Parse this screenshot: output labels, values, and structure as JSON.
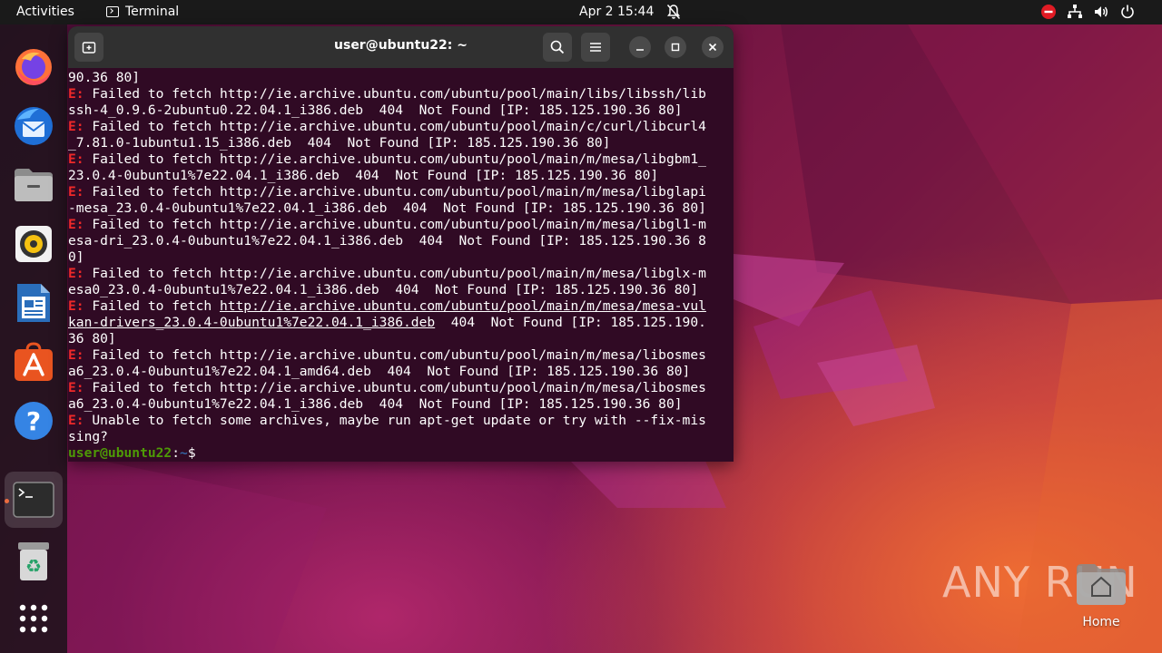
{
  "topbar": {
    "activities": "Activities",
    "app_name": "Terminal",
    "clock": "Apr 2  15:44"
  },
  "dock": {
    "items": [
      {
        "name": "firefox-icon"
      },
      {
        "name": "thunderbird-icon"
      },
      {
        "name": "files-icon"
      },
      {
        "name": "rhythmbox-icon"
      },
      {
        "name": "libreoffice-writer-icon"
      },
      {
        "name": "app-center-icon"
      },
      {
        "name": "help-icon"
      },
      {
        "name": "terminal-icon"
      },
      {
        "name": "trash-icon"
      },
      {
        "name": "show-apps-icon"
      }
    ]
  },
  "terminal": {
    "title": "user@ubuntu22: ~",
    "lines": [
      {
        "e": "",
        "t": "90.36 80]"
      },
      {
        "e": "E:",
        "t": " Failed to fetch http://ie.archive.ubuntu.com/ubuntu/pool/main/libs/libssh/lib"
      },
      {
        "e": "",
        "t": "ssh-4_0.9.6-2ubuntu0.22.04.1_i386.deb  404  Not Found [IP: 185.125.190.36 80]"
      },
      {
        "e": "E:",
        "t": " Failed to fetch http://ie.archive.ubuntu.com/ubuntu/pool/main/c/curl/libcurl4"
      },
      {
        "e": "",
        "t": "_7.81.0-1ubuntu1.15_i386.deb  404  Not Found [IP: 185.125.190.36 80]"
      },
      {
        "e": "E:",
        "t": " Failed to fetch http://ie.archive.ubuntu.com/ubuntu/pool/main/m/mesa/libgbm1_"
      },
      {
        "e": "",
        "t": "23.0.4-0ubuntu1%7e22.04.1_i386.deb  404  Not Found [IP: 185.125.190.36 80]"
      },
      {
        "e": "E:",
        "t": " Failed to fetch http://ie.archive.ubuntu.com/ubuntu/pool/main/m/mesa/libglapi"
      },
      {
        "e": "",
        "t": "-mesa_23.0.4-0ubuntu1%7e22.04.1_i386.deb  404  Not Found [IP: 185.125.190.36 80]"
      },
      {
        "e": "E:",
        "t": " Failed to fetch http://ie.archive.ubuntu.com/ubuntu/pool/main/m/mesa/libgl1-m"
      },
      {
        "e": "",
        "t": "esa-dri_23.0.4-0ubuntu1%7e22.04.1_i386.deb  404  Not Found [IP: 185.125.190.36 8"
      },
      {
        "e": "",
        "t": "0]"
      },
      {
        "e": "E:",
        "t": " Failed to fetch http://ie.archive.ubuntu.com/ubuntu/pool/main/m/mesa/libglx-m"
      },
      {
        "e": "",
        "t": "esa0_23.0.4-0ubuntu1%7e22.04.1_i386.deb  404  Not Found [IP: 185.125.190.36 80]"
      },
      {
        "e": "E:",
        "t": " Failed to fetch ",
        "link": "http://ie.archive.ubuntu.com/ubuntu/pool/main/m/mesa/mesa-vul"
      },
      {
        "e": "",
        "t": "",
        "link": "kan-drivers_23.0.4-0ubuntu1%7e22.04.1_i386.deb",
        "after": "  404  Not Found [IP: 185.125.190."
      },
      {
        "e": "",
        "t": "36 80]"
      },
      {
        "e": "E:",
        "t": " Failed to fetch http://ie.archive.ubuntu.com/ubuntu/pool/main/m/mesa/libosmes"
      },
      {
        "e": "",
        "t": "a6_23.0.4-0ubuntu1%7e22.04.1_amd64.deb  404  Not Found [IP: 185.125.190.36 80]"
      },
      {
        "e": "E:",
        "t": " Failed to fetch http://ie.archive.ubuntu.com/ubuntu/pool/main/m/mesa/libosmes"
      },
      {
        "e": "",
        "t": "a6_23.0.4-0ubuntu1%7e22.04.1_i386.deb  404  Not Found [IP: 185.125.190.36 80]"
      },
      {
        "e": "E:",
        "t": " Unable to fetch some archives, maybe run apt-get update or try with --fix-mis"
      },
      {
        "e": "",
        "t": "sing?"
      }
    ],
    "prompt_user": "user@ubuntu22",
    "prompt_sep": ":",
    "prompt_path": "~",
    "prompt_symbol": "$"
  },
  "desktop": {
    "home_label": "Home",
    "watermark": "ANY RUN"
  }
}
